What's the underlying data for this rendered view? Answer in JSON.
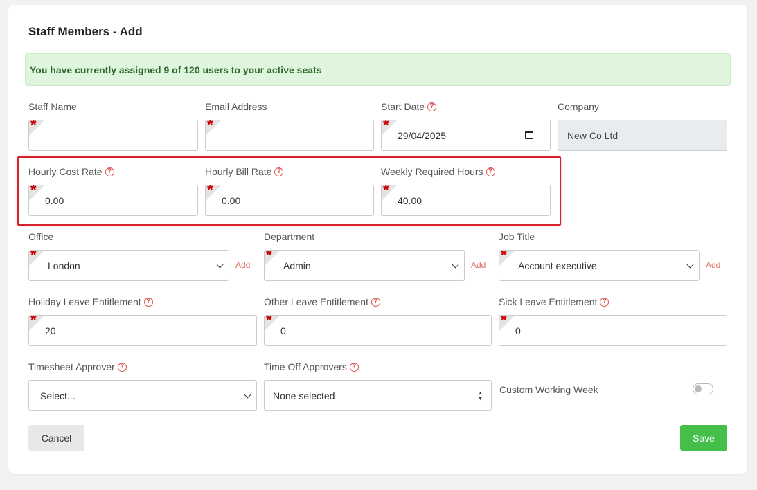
{
  "page": {
    "title": "Staff Members - Add",
    "alert": "You have currently assigned 9 of 120 users to your active seats"
  },
  "labels": {
    "staff_name": "Staff Name",
    "email": "Email Address",
    "start_date": "Start Date",
    "company": "Company",
    "hourly_cost": "Hourly Cost Rate",
    "hourly_bill": "Hourly Bill Rate",
    "weekly_hours": "Weekly Required Hours",
    "office": "Office",
    "department": "Department",
    "job_title": "Job Title",
    "holiday_leave": "Holiday Leave Entitlement",
    "other_leave": "Other Leave Entitlement",
    "sick_leave": "Sick Leave Entitlement",
    "timesheet_approver": "Timesheet Approver",
    "time_off_approvers": "Time Off Approvers",
    "custom_week": "Custom Working Week"
  },
  "values": {
    "staff_name": "",
    "email": "",
    "start_date": "29/04/2025",
    "company": "New Co Ltd",
    "hourly_cost": "0.00",
    "hourly_bill": "0.00",
    "weekly_hours": "40.00",
    "office": "London",
    "department": "Admin",
    "job_title": "Account executive",
    "holiday_leave": "20",
    "other_leave": "0",
    "sick_leave": "0",
    "timesheet_approver": "Select...",
    "time_off_approvers": "None selected",
    "custom_week_enabled": false
  },
  "actions": {
    "add": "Add",
    "cancel": "Cancel",
    "save": "Save"
  },
  "icons": {
    "help": "?",
    "required": "*"
  },
  "colors": {
    "accent_red": "#d9534f",
    "save_green": "#44bf4a",
    "alert_bg": "#dff5dd",
    "highlight_red": "#d6202a"
  }
}
